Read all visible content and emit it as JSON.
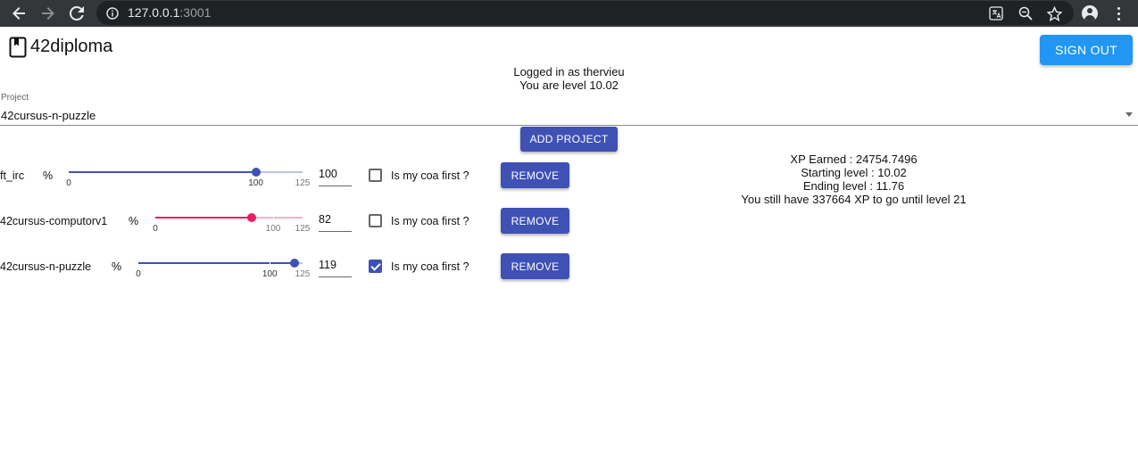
{
  "browser": {
    "url_host": "127.0.0.1",
    "url_port": ":3001"
  },
  "app": {
    "title": "42diploma",
    "sign_out_label": "SIGN OUT"
  },
  "user": {
    "logged_in_text": "Logged in as thervieu",
    "level_text": "You are level 10.02"
  },
  "project_select": {
    "label": "Project",
    "value": "42cursus-n-puzzle"
  },
  "add_project_label": "ADD PROJECT",
  "projects": [
    {
      "name": "ft_irc",
      "percent_symbol": "%",
      "value": "100",
      "slider_value": 100,
      "slider_min": 0,
      "slider_max": 125,
      "ticks": [
        "0",
        "100",
        "125"
      ],
      "color": "#3f51b5",
      "coa_label": "Is my coa first ?",
      "coa_checked": false,
      "remove_label": "REMOVE"
    },
    {
      "name": "42cursus-computorv1",
      "percent_symbol": "%",
      "value": "82",
      "slider_value": 82,
      "slider_min": 0,
      "slider_max": 125,
      "ticks": [
        "0",
        "100",
        "125"
      ],
      "color": "#e91e63",
      "coa_label": "Is my coa first ?",
      "coa_checked": false,
      "remove_label": "REMOVE"
    },
    {
      "name": "42cursus-n-puzzle",
      "percent_symbol": "%",
      "value": "119",
      "slider_value": 119,
      "slider_min": 0,
      "slider_max": 125,
      "ticks": [
        "0",
        "100",
        "125"
      ],
      "color": "#3f51b5",
      "coa_label": "Is my coa first ?",
      "coa_checked": true,
      "remove_label": "REMOVE"
    }
  ],
  "xp": {
    "earned": "XP Earned : 24754.7496",
    "starting": "Starting level : 10.02",
    "ending": "Ending level : 11.76",
    "remaining": "You still have 337664 XP to go until level 21"
  },
  "colors": {
    "primary": "#3f51b5",
    "secondary": "#e91e63",
    "sign_out": "#2196f3"
  }
}
